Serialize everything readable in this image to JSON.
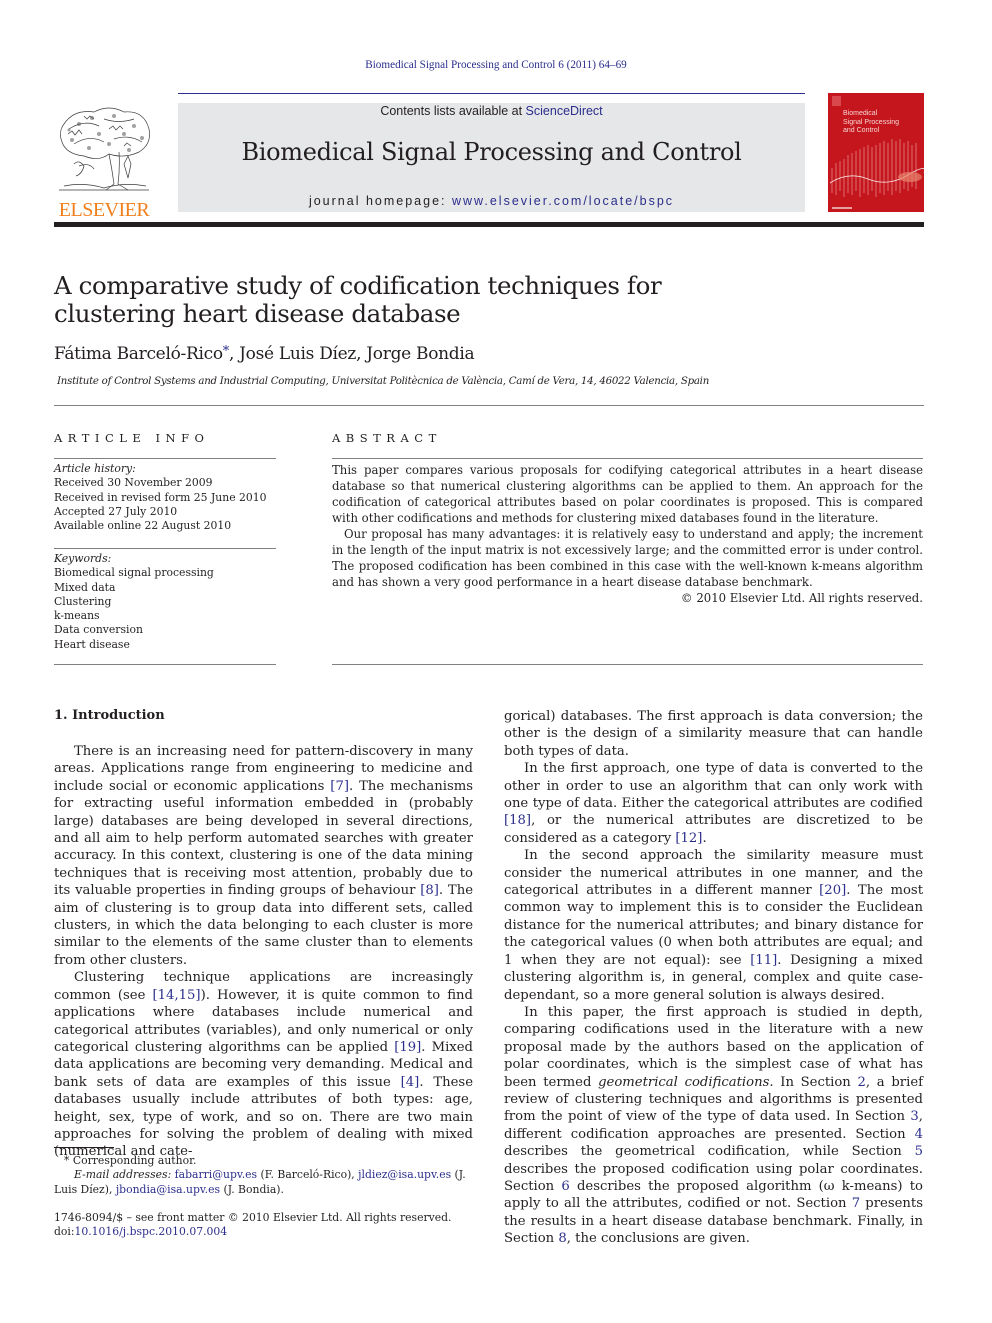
{
  "header": {
    "running_head": "Biomedical Signal Processing and Control 6 (2011) 64–69",
    "contents_prefix": "Contents lists available at ",
    "contents_link": "ScienceDirect",
    "journal_name": "Biomedical Signal Processing and Control",
    "homepage_prefix": "journal homepage: ",
    "homepage_link": "www.elsevier.com/locate/bspc",
    "publisher_logo_text": "ELSEVIER",
    "cover_title_lines": [
      "Biomedical",
      "Signal Processing",
      "and Control"
    ]
  },
  "article": {
    "title": "A comparative study of codification techniques for clustering heart disease database",
    "authors": {
      "author1": "Fátima Barceló-Rico",
      "author1_mark": "*",
      "rest": ", José Luis Díez, Jorge Bondia"
    },
    "affiliation": "Institute of Control Systems and Industrial Computing, Universitat Politècnica de València, Camí de Vera, 14, 46022 Valencia, Spain"
  },
  "article_info": {
    "heading": "ARTICLE INFO",
    "history_label": "Article history:",
    "history": [
      "Received 30 November 2009",
      "Received in revised form 25 June 2010",
      "Accepted 27 July 2010",
      "Available online 22 August 2010"
    ],
    "keywords_label": "Keywords:",
    "keywords": [
      "Biomedical signal processing",
      "Mixed data",
      "Clustering",
      "k-means",
      "Data conversion",
      "Heart disease"
    ]
  },
  "abstract": {
    "heading": "ABSTRACT",
    "p1": "This paper compares various proposals for codifying categorical attributes in a heart disease database so that numerical clustering algorithms can be applied to them. An approach for the codification of categorical attributes based on polar coordinates is proposed. This is compared with other codifications and methods for clustering mixed databases found in the literature.",
    "p2": "Our proposal has many advantages: it is relatively easy to understand and apply; the increment in the length of the input matrix is not excessively large; and the committed error is under control. The proposed codification has been combined in this case with the well-known k-means algorithm and has shown a very good performance in a heart disease database benchmark.",
    "copyright": "© 2010 Elsevier Ltd. All rights reserved."
  },
  "body": {
    "section_heading": "1.  Introduction",
    "left": {
      "p1": {
        "a": "There is an increasing need for pattern-discovery in many areas. Applications range from engineering to medicine and include social or economic applications ",
        "ref1": "[7]",
        "b": ". The mechanisms for extracting useful information embedded in (probably large) databases are being developed in several directions, and all aim to help perform automated searches with greater accuracy. In this context, clustering is one of the data mining techniques that is receiving most attention, probably due to its valuable properties in finding groups of behaviour ",
        "ref2": "[8]",
        "c": ". The aim of clustering is to group data into different sets, called clusters, in which the data belonging to each cluster is more similar to the elements of the same cluster than to elements from other clusters."
      },
      "p2": {
        "a": "Clustering technique applications are increasingly common (see ",
        "ref1": "[14,15]",
        "b": "). However, it is quite common to find applications where databases include numerical and categorical attributes (variables), and only numerical or only categorical clustering algorithms can be applied ",
        "ref2": "[19]",
        "c": ". Mixed data applications are becoming very demanding. Medical and bank sets of data are examples of this issue ",
        "ref3": "[4]",
        "d": ". These databases usually include attributes of both types: age, height, sex, type of work, and so on. There are two main approaches for solving the problem of dealing with mixed (numerical and cate-"
      }
    },
    "right": {
      "p0": "gorical) databases. The first approach is data conversion; the other is the design of a similarity measure that can handle both types of data.",
      "p1": {
        "a": "In the first approach, one type of data is converted to the other in order to use an algorithm that can only work with one type of data. Either the categorical attributes are codified ",
        "ref1": "[18]",
        "b": ", or the numerical attributes are discretized to be considered as a category ",
        "ref2": "[12]",
        "c": "."
      },
      "p2": {
        "a": "In the second approach the similarity measure must consider the numerical attributes in one manner, and the categorical attributes in a different manner ",
        "ref1": "[20]",
        "b": ". The most common way to implement this is to consider the Euclidean distance for the numerical attributes; and binary distance for the categorical values (0 when both attributes are equal; and 1 when they are not equal): see ",
        "ref2": "[11]",
        "c": ". Designing a mixed clustering algorithm is, in general, complex and quite case-dependant, so a more general solution is always desired."
      },
      "p3": {
        "a": "In this paper, the first approach is studied in depth, comparing codifications used in the literature with a new proposal made by the authors based on the application of polar coordinates, which is the simplest case of what has been termed ",
        "em": "geometrical codifications",
        "b": ". In Section ",
        "s2": "2",
        "c": ", a brief review of clustering techniques and algorithms is presented from the point of view of the type of data used. In Section ",
        "s3": "3",
        "d": ", different codification approaches are presented. Section ",
        "s4": "4",
        "e": " describes the geometrical codification, while Section ",
        "s5": "5",
        "f": " describes the proposed codification using polar coordinates. Section ",
        "s6": "6",
        "g": " describes the proposed algorithm (ω k-means) to apply to all the attributes, codified or not. Section ",
        "s7": "7",
        "h": " presents the results in a heart disease database benchmark. Finally, in Section ",
        "s8": "8",
        "i": ", the conclusions are given."
      }
    }
  },
  "footnote": {
    "mark": "*",
    "corresponding": "Corresponding author.",
    "email_label": "E-mail addresses:",
    "email1": "fabarri@upv.es",
    "name1": " (F. Barceló-Rico), ",
    "email2": "jldiez@isa.upv.es",
    "name2": " (J. Luis Díez),",
    "email3": "jbondia@isa.upv.es",
    "name3": " (J. Bondia)."
  },
  "front_matter": {
    "issn_line": "1746-8094/$ – see front matter © 2010 Elsevier Ltd. All rights reserved.",
    "doi_prefix": "doi:",
    "doi": "10.1016/j.bspc.2010.07.004"
  },
  "colors": {
    "link": "#2b2e8c",
    "elsevier_orange": "#f07f1c",
    "cover_red": "#c4161c",
    "masthead_gray": "#e6e7e8",
    "text": "#231f20"
  }
}
